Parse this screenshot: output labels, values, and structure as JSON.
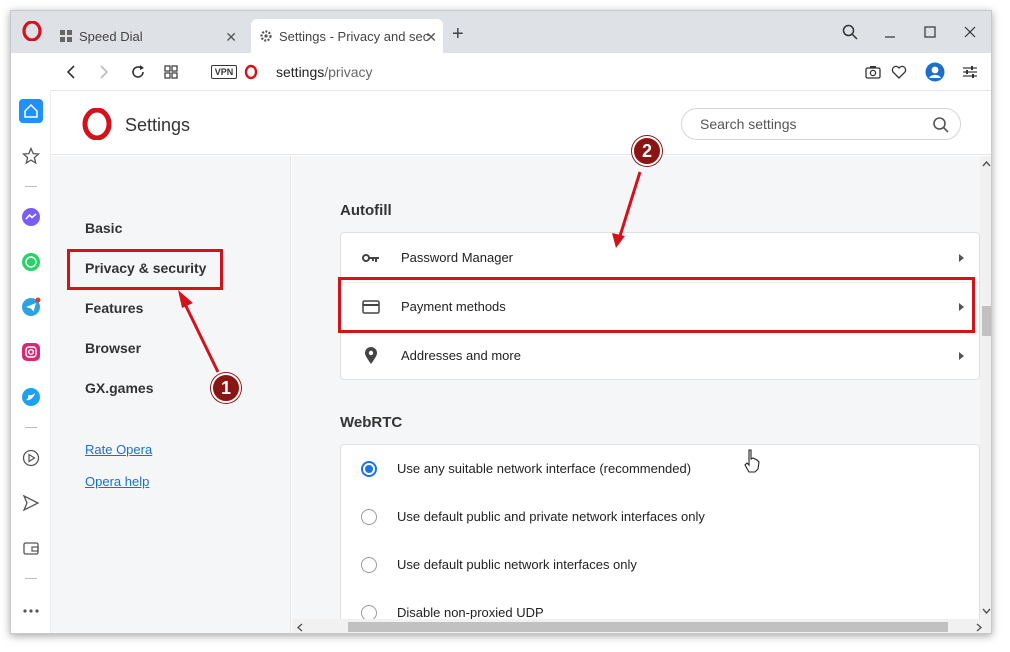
{
  "tabs": [
    {
      "label": "Speed Dial",
      "icon": "grid-icon"
    },
    {
      "label": "Settings - Privacy and security",
      "icon": "gear-icon"
    }
  ],
  "address_bar": {
    "vpn_label": "VPN",
    "url_host": "settings",
    "url_path": "/privacy"
  },
  "settings": {
    "title": "Settings",
    "search_placeholder": "Search settings"
  },
  "left_nav": {
    "items": [
      {
        "label": "Basic"
      },
      {
        "label": "Privacy & security"
      },
      {
        "label": "Features"
      },
      {
        "label": "Browser"
      },
      {
        "label": "GX.games"
      }
    ],
    "links": [
      {
        "label": "Rate Opera"
      },
      {
        "label": "Opera help"
      }
    ]
  },
  "autofill": {
    "title": "Autofill",
    "rows": [
      {
        "label": "Password Manager",
        "icon": "key-icon"
      },
      {
        "label": "Payment methods",
        "icon": "credit-card-icon"
      },
      {
        "label": "Addresses and more",
        "icon": "location-pin-icon"
      }
    ]
  },
  "webrtc": {
    "title": "WebRTC",
    "options": [
      {
        "label": "Use any suitable network interface (recommended)",
        "selected": true
      },
      {
        "label": "Use default public and private network interfaces only",
        "selected": false
      },
      {
        "label": "Use default public network interfaces only",
        "selected": false
      },
      {
        "label": "Disable non-proxied UDP",
        "selected": false
      }
    ]
  },
  "annotations": {
    "marker1": "1",
    "marker2": "2"
  },
  "colors": {
    "opera_red": "#d4121b",
    "accent_blue": "#1a73e8",
    "highlight_red": "#d4121b",
    "marker_bg": "#8b1414"
  }
}
